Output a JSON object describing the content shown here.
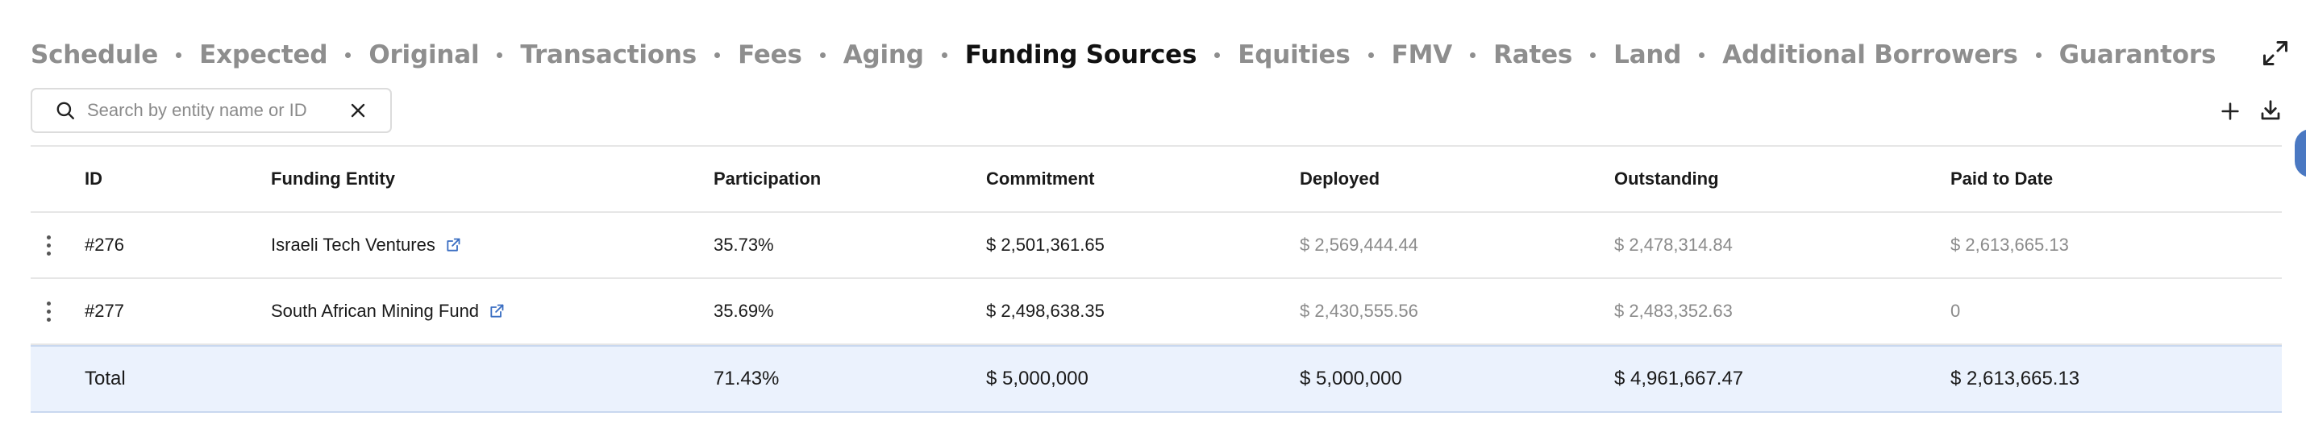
{
  "tabs": [
    {
      "label": "Schedule",
      "active": false
    },
    {
      "label": "Expected",
      "active": false
    },
    {
      "label": "Original",
      "active": false
    },
    {
      "label": "Transactions",
      "active": false
    },
    {
      "label": "Fees",
      "active": false
    },
    {
      "label": "Aging",
      "active": false
    },
    {
      "label": "Funding Sources",
      "active": true
    },
    {
      "label": "Equities",
      "active": false
    },
    {
      "label": "FMV",
      "active": false
    },
    {
      "label": "Rates",
      "active": false
    },
    {
      "label": "Land",
      "active": false
    },
    {
      "label": "Additional Borrowers",
      "active": false
    },
    {
      "label": "Guarantors",
      "active": false
    }
  ],
  "search": {
    "placeholder": "Search by entity name or ID",
    "value": ""
  },
  "columns": {
    "id": "ID",
    "entity": "Funding Entity",
    "participation": "Participation",
    "commitment": "Commitment",
    "deployed": "Deployed",
    "outstanding": "Outstanding",
    "paid": "Paid to Date"
  },
  "rows": [
    {
      "id": "#276",
      "entity": "Israeli Tech Ventures",
      "participation": "35.73%",
      "commitment": "$ 2,501,361.65",
      "deployed": "$ 2,569,444.44",
      "outstanding": "$ 2,478,314.84",
      "paid": "$ 2,613,665.13"
    },
    {
      "id": "#277",
      "entity": "South African Mining Fund",
      "participation": "35.69%",
      "commitment": "$ 2,498,638.35",
      "deployed": "$ 2,430,555.56",
      "outstanding": "$ 2,483,352.63",
      "paid": "0"
    }
  ],
  "total": {
    "label": "Total",
    "participation": "71.43%",
    "commitment": "$ 5,000,000",
    "deployed": "$ 5,000,000",
    "outstanding": "$ 4,961,667.47",
    "paid": "$ 2,613,665.13"
  },
  "colors": {
    "accent": "#3a6ec2",
    "total_bg": "#ebf2fd",
    "muted_text": "#8b8b8b",
    "tab_inactive": "#8e8e8e"
  },
  "icons": {
    "expand": "expand-icon",
    "search": "search-icon",
    "clear": "close-icon",
    "add": "plus-icon",
    "download": "download-icon",
    "row_menu": "kebab-icon",
    "open_entity": "external-link-icon"
  }
}
